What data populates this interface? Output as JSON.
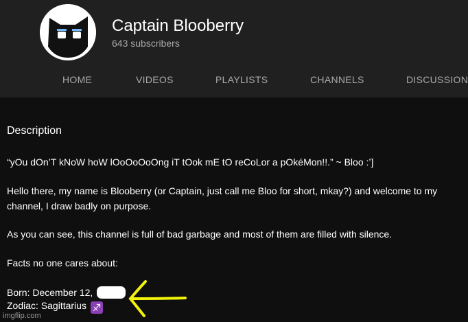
{
  "channel": {
    "name": "Captain Blooberry",
    "subscribers": "643 subscribers"
  },
  "tabs": [
    {
      "label": "HOME"
    },
    {
      "label": "VIDEOS"
    },
    {
      "label": "PLAYLISTS"
    },
    {
      "label": "CHANNELS"
    },
    {
      "label": "DISCUSSION"
    }
  ],
  "description": {
    "heading": "Description",
    "quote": "“yOu dOn’T kNoW hoW lOoOoOoOng iT tOok mE tO reCoLor a pOkéMon!!.” ~ Bloo :’]",
    "intro_line1": "Hello there, my name is Blooberry (or Captain, just call me Bloo for short, mkay?) and welcome to my",
    "intro_line2": "channel, I draw badly on purpose.",
    "garbage": "As you can see, this channel is full of bad garbage and most of them are filled with silence.",
    "facts_heading": "Facts no one cares about:",
    "born": "Born: December 12,",
    "zodiac": "Zodiac: Sagittarius",
    "zodiac_symbol": "♐"
  },
  "watermark": "imgflip.com",
  "colors": {
    "header_bg": "#202020",
    "page_bg": "#0f0f0f",
    "arrow": "#f2f20a",
    "zodiac_badge": "#8a3fb4"
  },
  "icons": {
    "avatar": "cat-face-avatar",
    "arrow": "hand-drawn-arrow-left"
  }
}
